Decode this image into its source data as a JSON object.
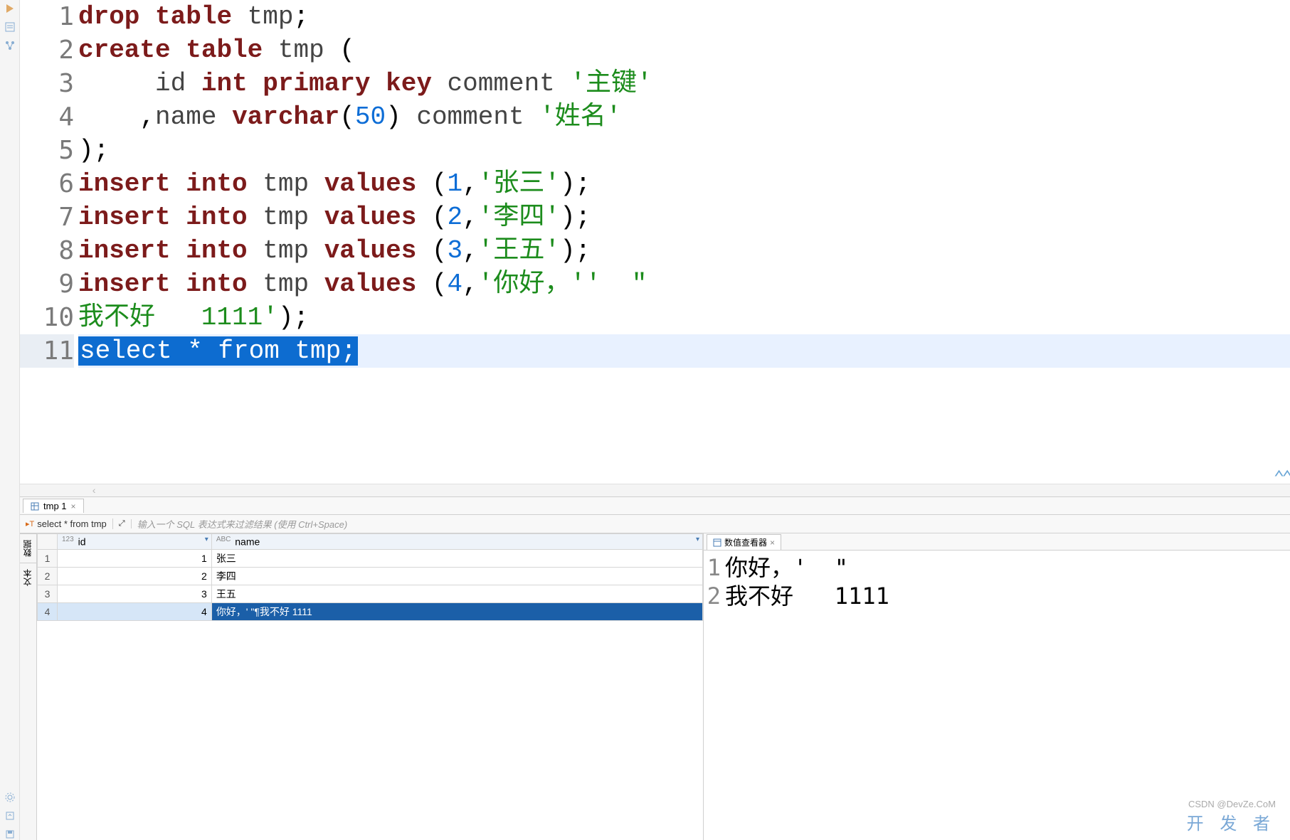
{
  "editor": {
    "lines": [
      {
        "n": 1,
        "html": "<span class='kw'>drop</span> <span class='kw'>table</span> <span class='def'>tmp</span>;"
      },
      {
        "n": 2,
        "html": "<span class='kw'>create</span> <span class='kw'>table</span> <span class='def'>tmp</span> ("
      },
      {
        "n": 3,
        "html": "     <span class='def'>id</span> <span class='ty'>int</span> <span class='kw'>primary</span> <span class='kw'>key</span> <span class='def'>comment</span> <span class='str'>'主键'</span>"
      },
      {
        "n": 4,
        "html": "    ,<span class='def'>name</span> <span class='ty'>varchar</span>(<span class='num'>50</span>) <span class='def'>comment</span> <span class='str'>'姓名'</span>"
      },
      {
        "n": 5,
        "html": ");"
      },
      {
        "n": 6,
        "html": "<span class='kw'>insert</span> <span class='kw'>into</span> <span class='def'>tmp</span> <span class='kw'>values</span> (<span class='num'>1</span>,<span class='str'>'张三'</span>);"
      },
      {
        "n": 7,
        "html": "<span class='kw'>insert</span> <span class='kw'>into</span> <span class='def'>tmp</span> <span class='kw'>values</span> (<span class='num'>2</span>,<span class='str'>'李四'</span>);"
      },
      {
        "n": 8,
        "html": "<span class='kw'>insert</span> <span class='kw'>into</span> <span class='def'>tmp</span> <span class='kw'>values</span> (<span class='num'>3</span>,<span class='str'>'王五'</span>);"
      },
      {
        "n": 9,
        "html": "<span class='kw'>insert</span> <span class='kw'>into</span> <span class='def'>tmp</span> <span class='kw'>values</span> (<span class='num'>4</span>,<span class='str'>'你好，''  &quot;</span>"
      },
      {
        "n": 10,
        "html": "<span class='str'>我不好   1111'</span>);"
      },
      {
        "n": 11,
        "html": "<span class='sel-stmt'>select * from tmp;</span>",
        "active": true
      }
    ]
  },
  "tabs": {
    "result_tab": "tmp 1",
    "close_x": "×"
  },
  "filter": {
    "stmt_label": "select * from tmp",
    "hint": "输入一个 SQL 表达式来过滤结果 (使用 Ctrl+Space)"
  },
  "grid_side": {
    "tab1": "数据",
    "tab2": "文本"
  },
  "grid": {
    "columns": [
      {
        "name": "id",
        "dtype": "123"
      },
      {
        "name": "name",
        "dtype": "ABC"
      }
    ],
    "rows": [
      {
        "rn": "1",
        "id": "1",
        "name": "张三"
      },
      {
        "rn": "2",
        "id": "2",
        "name": "李四"
      },
      {
        "rn": "3",
        "id": "3",
        "name": "王五"
      },
      {
        "rn": "4",
        "id": "4",
        "name": "你好，' \"¶我不好 1111",
        "selected": true
      }
    ]
  },
  "value_viewer": {
    "tab_label": "数值查看器",
    "close_x": "×",
    "lines": [
      {
        "n": "1",
        "text": "你好，'  \""
      },
      {
        "n": "2",
        "text": "我不好   1111"
      }
    ]
  },
  "watermark": {
    "sub": "CSDN @",
    "main": "开 发 者",
    "brand": "DevZe.CoM"
  }
}
